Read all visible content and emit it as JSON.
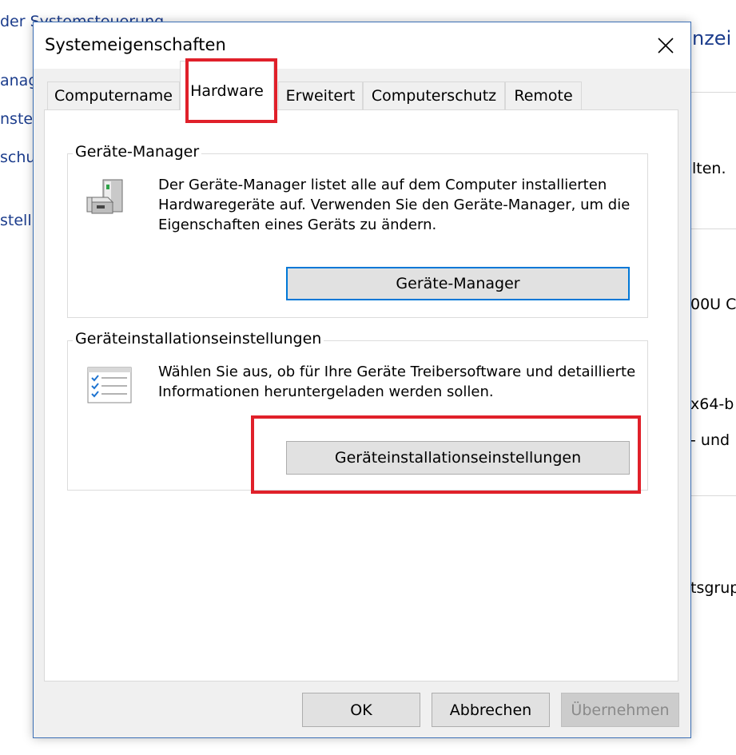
{
  "background": {
    "left_lines": [
      "der Systemsteuerung",
      "anag",
      "nstel",
      "schu",
      "stell"
    ],
    "right_lines": [
      "nzei",
      "lten.",
      "00U C",
      "x64-b",
      "- und",
      "tsgrup"
    ]
  },
  "dialog": {
    "title": "Systemeigenschaften",
    "tabs": [
      {
        "label": "Computername"
      },
      {
        "label": "Hardware"
      },
      {
        "label": "Erweitert"
      },
      {
        "label": "Computerschutz"
      },
      {
        "label": "Remote"
      }
    ],
    "active_tab": "Hardware",
    "device_manager": {
      "legend": "Geräte-Manager",
      "description": "Der Geräte-Manager listet alle auf dem Computer installierten Hardwaregeräte auf. Verwenden Sie den Geräte-Manager, um die Eigenschaften eines Geräts zu ändern.",
      "button_label": "Geräte-Manager",
      "icon": "device-manager-icon"
    },
    "device_installation": {
      "legend": "Geräteinstallationseinstellungen",
      "description": "Wählen Sie aus, ob für Ihre Geräte Treibersoftware und detaillierte Informationen heruntergeladen werden sollen.",
      "button_label": "Geräteinstallationseinstellungen",
      "icon": "checklist-icon"
    },
    "footer": {
      "ok_label": "OK",
      "cancel_label": "Abbrechen",
      "apply_label": "Übernehmen"
    }
  },
  "colors": {
    "accent": "#0078d7",
    "highlight": "#e0202a",
    "link": "#1b3c8c"
  }
}
